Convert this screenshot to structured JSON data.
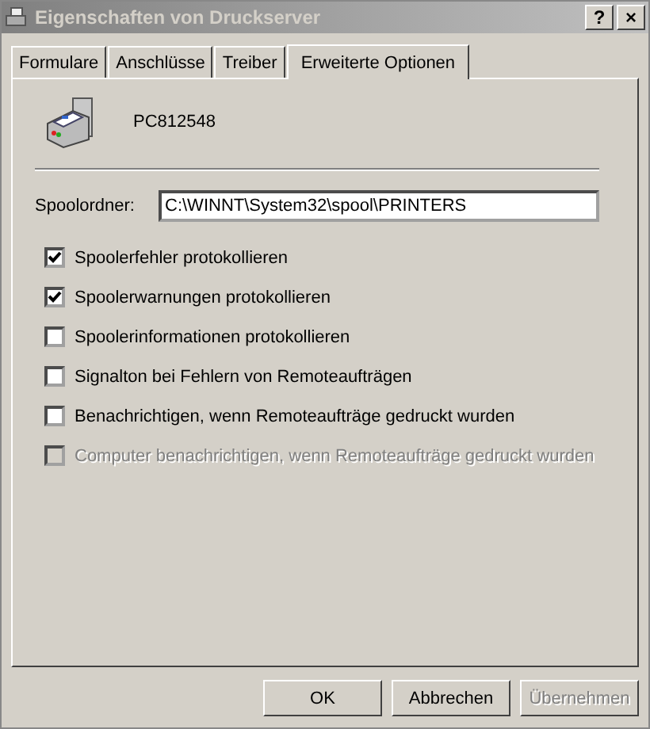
{
  "window": {
    "title": "Eigenschaften von Druckserver",
    "help_button": "?",
    "close_button": "×"
  },
  "tabs": [
    {
      "label": "Formulare",
      "selected": false
    },
    {
      "label": "Anschlüsse",
      "selected": false
    },
    {
      "label": "Treiber",
      "selected": false
    },
    {
      "label": "Erweiterte Optionen",
      "selected": true
    }
  ],
  "server_name": "PC812548",
  "spool_folder": {
    "label": "Spoolordner:",
    "value": "C:\\WINNT\\System32\\spool\\PRINTERS"
  },
  "options": [
    {
      "label": "Spoolerfehler protokollieren",
      "checked": true,
      "disabled": false
    },
    {
      "label": "Spoolerwarnungen protokollieren",
      "checked": true,
      "disabled": false
    },
    {
      "label": "Spoolerinformationen protokollieren",
      "checked": false,
      "disabled": false
    },
    {
      "label": "Signalton bei Fehlern von Remoteaufträgen",
      "checked": false,
      "disabled": false
    },
    {
      "label": "Benachrichtigen, wenn Remoteaufträge gedruckt wurden",
      "checked": false,
      "disabled": false
    },
    {
      "label": "Computer benachrichtigen, wenn Remoteaufträge gedruckt wurden",
      "checked": false,
      "disabled": true
    }
  ],
  "buttons": [
    {
      "label": "OK",
      "disabled": false
    },
    {
      "label": "Abbrechen",
      "disabled": false
    },
    {
      "label": "Übernehmen",
      "disabled": true
    }
  ]
}
